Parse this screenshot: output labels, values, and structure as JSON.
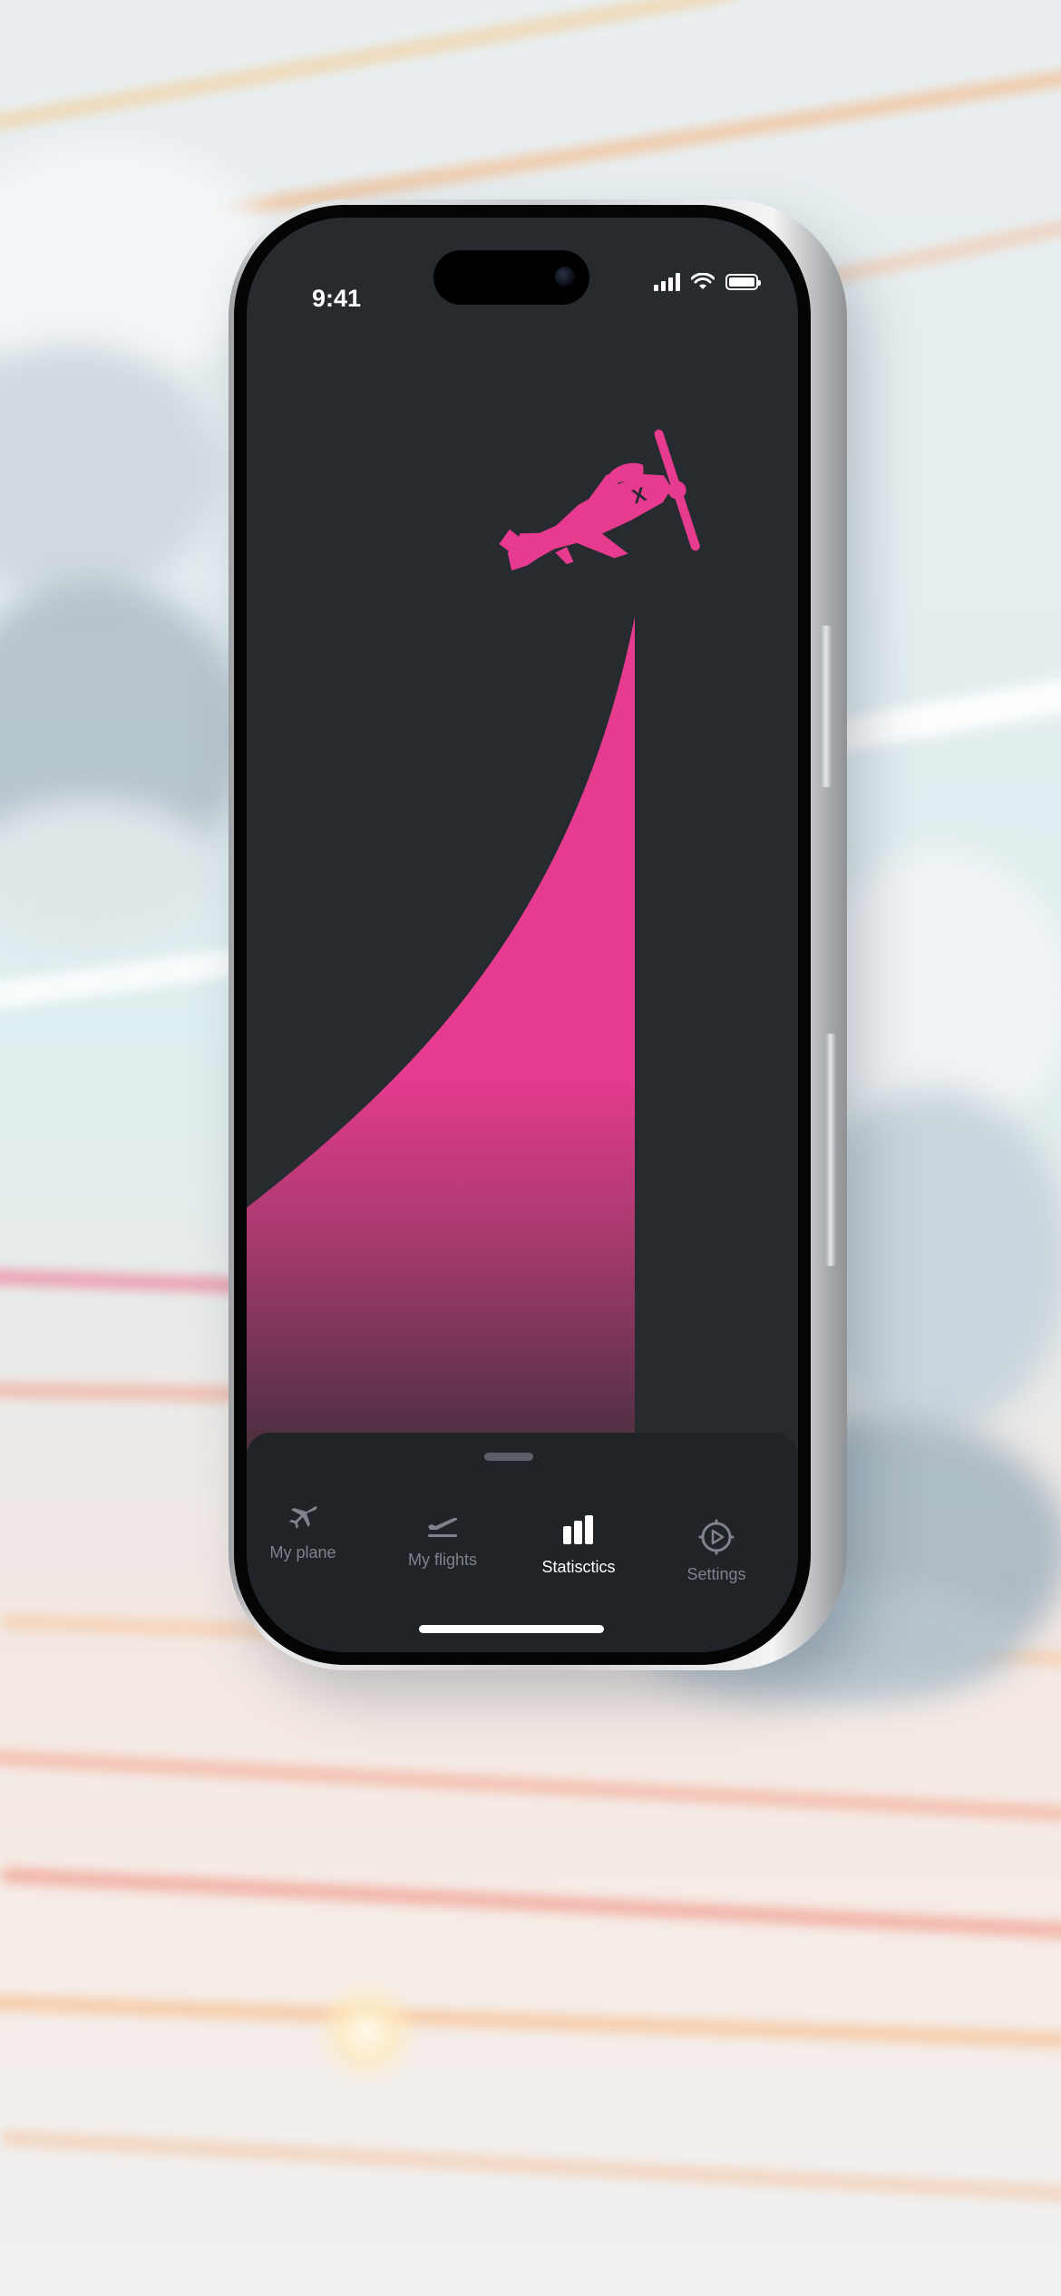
{
  "status_bar": {
    "time": "9:41"
  },
  "graph": {
    "fill_color": "#e63b8f",
    "background": "#272a2f"
  },
  "tab_bar": {
    "active_tab": "Statisctics",
    "tabs": [
      {
        "label": "My plane",
        "icon": "airplane-icon"
      },
      {
        "label": "My flights",
        "icon": "takeoff-icon"
      },
      {
        "label": "Statisctics",
        "icon": "bar-chart-icon"
      },
      {
        "label": "Settings",
        "icon": "settings-icon"
      }
    ]
  }
}
